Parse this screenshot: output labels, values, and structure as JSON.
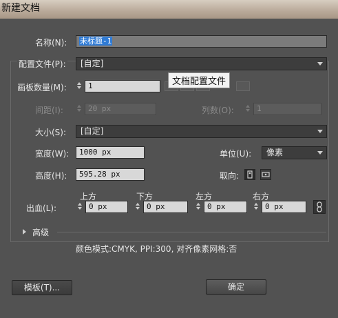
{
  "window": {
    "title": "新建文档"
  },
  "name": {
    "label": "名称(N):",
    "value": "未标题-1"
  },
  "profile": {
    "label": "配置文件(P):",
    "value": "[自定]",
    "tooltip": "文档配置文件"
  },
  "artboards": {
    "count_label": "画板数量(M):",
    "count_value": "1",
    "spacing_label": "间距(I):",
    "spacing_value": "20 px",
    "columns_label": "列数(O):",
    "columns_value": "1"
  },
  "size": {
    "label": "大小(S):",
    "value": "[自定]"
  },
  "width": {
    "label": "宽度(W):",
    "value": "1000 px"
  },
  "units": {
    "label": "单位(U):",
    "value": "像素"
  },
  "height": {
    "label": "高度(H):",
    "value": "595.28 px"
  },
  "orientation": {
    "label": "取向:"
  },
  "bleed": {
    "label": "出血(L):",
    "top_label": "上方",
    "top_value": "0 px",
    "bottom_label": "下方",
    "bottom_value": "0 px",
    "left_label": "左方",
    "left_value": "0 px",
    "right_label": "右方",
    "right_value": "0 px"
  },
  "advanced": {
    "label": "高级"
  },
  "summary": "颜色模式:CMYK, PPI:300, 对齐像素网格:否",
  "buttons": {
    "templates": "模板(T)...",
    "ok": "确定"
  }
}
